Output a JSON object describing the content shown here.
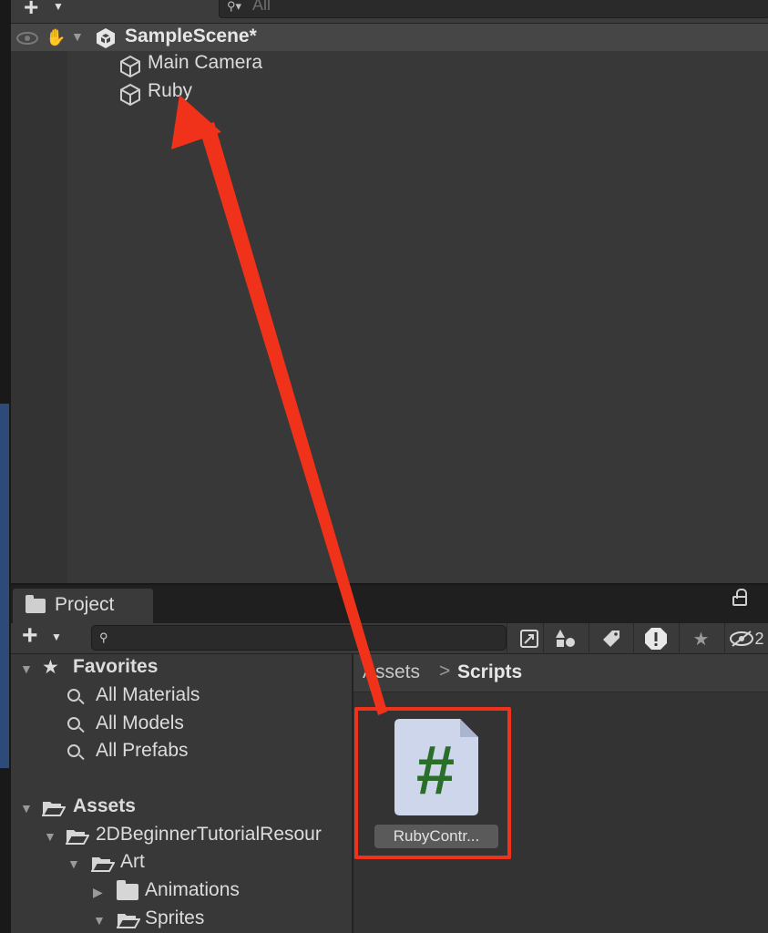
{
  "hierarchy": {
    "search_placeholder": "All",
    "scene_name": "SampleScene*",
    "objects": [
      {
        "label": "Main Camera"
      },
      {
        "label": "Ruby"
      }
    ]
  },
  "project": {
    "tab_label": "Project",
    "favorites": {
      "label": "Favorites",
      "items": [
        "All Materials",
        "All Models",
        "All Prefabs"
      ]
    },
    "assets_tree": {
      "root": "Assets",
      "children": [
        {
          "label": "2DBeginnerTutorialResour",
          "expanded": true
        },
        {
          "label": "Art",
          "expanded": true
        },
        {
          "label": "Animations",
          "expanded": false
        },
        {
          "label": "Sprites",
          "expanded": true
        }
      ]
    },
    "breadcrumb": {
      "root": "Assets",
      "separator": ">",
      "current": "Scripts"
    },
    "toolbar_badge": "2",
    "files": [
      {
        "name": "RubyContr...",
        "type": "csharp-script-icon",
        "glyph": "#"
      }
    ]
  },
  "annotation": {
    "color": "#f0321a",
    "description_icon": "arrow-icon"
  },
  "colors": {
    "script_icon_bg": "#cdd6ea",
    "script_hash": "#2a6e2a",
    "panel_bg": "#383838",
    "toolbar_bg": "#3c3c3c"
  }
}
